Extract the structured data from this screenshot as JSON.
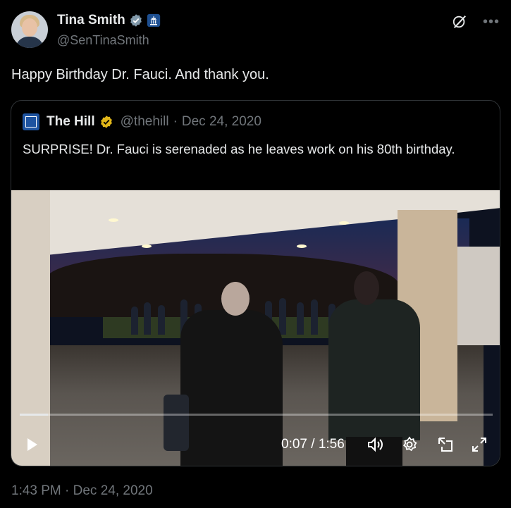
{
  "author": {
    "name": "Tina Smith",
    "handle": "@SenTinaSmith",
    "verified_icon": "verified-badge-icon",
    "affiliation_icon": "government-building-icon"
  },
  "tweet_text": "Happy Birthday Dr. Fauci. And thank you.",
  "quote": {
    "name": "The Hill",
    "handle": "@thehill",
    "separator": "·",
    "date": "Dec 24, 2020",
    "text": "SURPRISE! Dr. Fauci is serenaded as he leaves work on his 80th birthday."
  },
  "video": {
    "time": "0:07 / 1:56",
    "progress": 0.06
  },
  "timestamp": "1:43 PM · Dec 24, 2020",
  "colors": {
    "background": "#000000",
    "text": "#e7e9ea",
    "muted": "#71767b",
    "border": "#2f3336",
    "verified_blue": "#1d9bf0",
    "verified_gold": "#e2b719",
    "gov_badge": "#829aab"
  }
}
